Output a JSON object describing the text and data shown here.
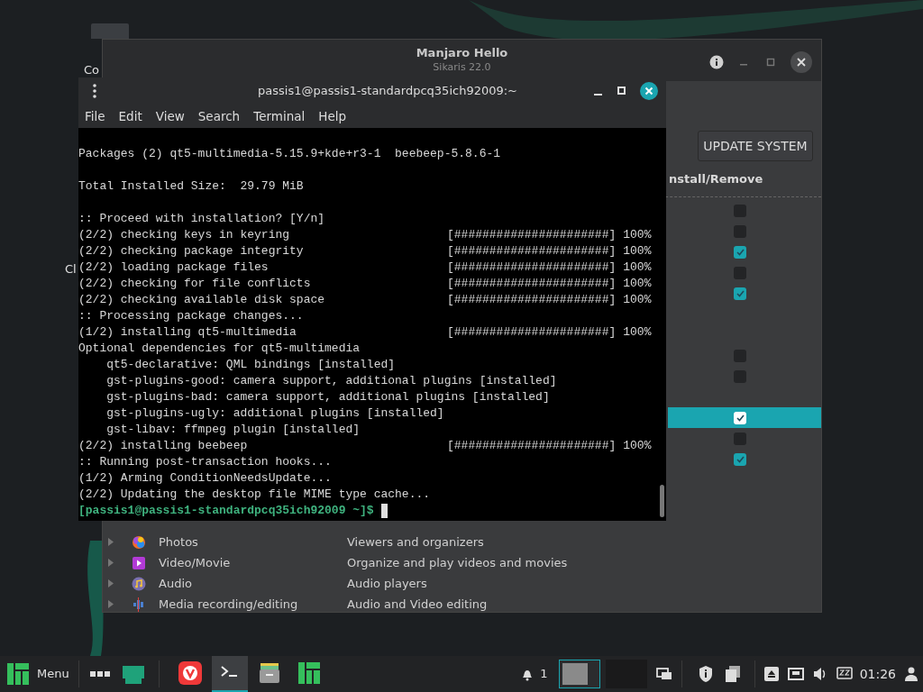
{
  "desktop": {
    "icons": [
      {
        "label": "Co"
      },
      {
        "label": "Cl"
      }
    ]
  },
  "hello_window": {
    "title": "Manjaro Hello",
    "subtitle": "Sikaris 22.0",
    "update_button": "UPDATE SYSTEM",
    "column_header": "nstall/Remove",
    "rows": [
      {
        "kind": "package",
        "checked": false,
        "selected": false
      },
      {
        "kind": "package",
        "checked": false,
        "selected": false
      },
      {
        "kind": "package",
        "checked": true,
        "selected": false
      },
      {
        "kind": "package",
        "checked": false,
        "selected": false
      },
      {
        "kind": "package",
        "checked": true,
        "selected": false
      },
      {
        "kind": "group"
      },
      {
        "kind": "group"
      },
      {
        "kind": "package",
        "checked": false,
        "selected": false
      },
      {
        "kind": "package",
        "checked": false,
        "selected": false
      },
      {
        "kind": "group"
      },
      {
        "kind": "package",
        "checked": true,
        "selected": true
      },
      {
        "kind": "package",
        "checked": false,
        "selected": false
      },
      {
        "kind": "package",
        "checked": true,
        "selected": false
      },
      {
        "kind": "group"
      },
      {
        "kind": "group"
      },
      {
        "kind": "group"
      },
      {
        "kind": "group",
        "name": "Photos",
        "description": "Viewers and organizers"
      },
      {
        "kind": "group",
        "name": "Video/Movie",
        "description": "Organize and play videos and movies"
      },
      {
        "kind": "group",
        "name": "Audio",
        "description": "Audio players"
      },
      {
        "kind": "group",
        "name": "Media recording/editing",
        "description": "Audio and Video editing"
      }
    ]
  },
  "terminal": {
    "title": "passis1@passis1-standardpcq35ich92009:~",
    "menu": [
      "File",
      "Edit",
      "View",
      "Search",
      "Terminal",
      "Help"
    ],
    "lines": [
      {
        "kind": "blank"
      },
      {
        "kind": "text",
        "text": "Packages (2) qt5-multimedia-5.15.9+kde+r3-1  beebeep-5.8.6-1"
      },
      {
        "kind": "blank"
      },
      {
        "kind": "text",
        "text": "Total Installed Size:  29.79 MiB"
      },
      {
        "kind": "blank"
      },
      {
        "kind": "text",
        "text": ":: Proceed with installation? [Y/n]"
      },
      {
        "kind": "progress",
        "text": "(2/2) checking keys in keyring",
        "bar": "[######################]",
        "percent": "100%"
      },
      {
        "kind": "progress",
        "text": "(2/2) checking package integrity",
        "bar": "[######################]",
        "percent": "100%"
      },
      {
        "kind": "progress",
        "text": "(2/2) loading package files",
        "bar": "[######################]",
        "percent": "100%"
      },
      {
        "kind": "progress",
        "text": "(2/2) checking for file conflicts",
        "bar": "[######################]",
        "percent": "100%"
      },
      {
        "kind": "progress",
        "text": "(2/2) checking available disk space",
        "bar": "[######################]",
        "percent": "100%"
      },
      {
        "kind": "text",
        "text": ":: Processing package changes..."
      },
      {
        "kind": "progress",
        "text": "(1/2) installing qt5-multimedia",
        "bar": "[######################]",
        "percent": "100%"
      },
      {
        "kind": "text",
        "text": "Optional dependencies for qt5-multimedia"
      },
      {
        "kind": "text",
        "text": "    qt5-declarative: QML bindings [installed]"
      },
      {
        "kind": "text",
        "text": "    gst-plugins-good: camera support, additional plugins [installed]"
      },
      {
        "kind": "text",
        "text": "    gst-plugins-bad: camera support, additional plugins [installed]"
      },
      {
        "kind": "text",
        "text": "    gst-plugins-ugly: additional plugins [installed]"
      },
      {
        "kind": "text",
        "text": "    gst-libav: ffmpeg plugin [installed]"
      },
      {
        "kind": "progress",
        "text": "(2/2) installing beebeep",
        "bar": "[######################]",
        "percent": "100%"
      },
      {
        "kind": "text",
        "text": ":: Running post-transaction hooks..."
      },
      {
        "kind": "text",
        "text": "(1/2) Arming ConditionNeedsUpdate..."
      },
      {
        "kind": "text",
        "text": "(2/2) Updating the desktop file MIME type cache..."
      },
      {
        "kind": "prompt",
        "text": "[passis1@passis1-standardpcq35ich92009 ~]$"
      }
    ]
  },
  "taskbar": {
    "menu_label": "Menu",
    "apps": [
      {
        "kind": "vivaldi",
        "selected": false
      },
      {
        "kind": "terminal",
        "selected": true
      },
      {
        "kind": "files",
        "selected": false
      },
      {
        "kind": "hello",
        "selected": false
      }
    ],
    "notifications": "1",
    "workspaces": [
      {
        "selected": true
      },
      {
        "selected": false
      }
    ],
    "clock": "01:26"
  }
}
